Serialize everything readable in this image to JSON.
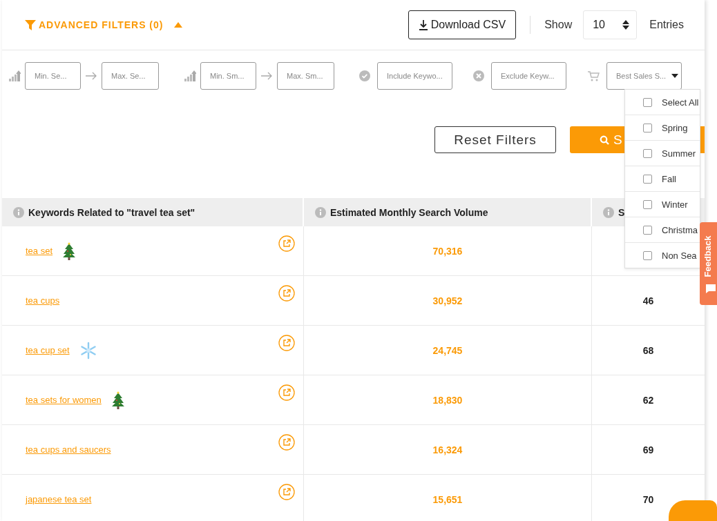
{
  "header": {
    "filters_title": "ADVANCED FILTERS (0)",
    "expanded": true,
    "download_button": "Download CSV",
    "show_label": "Show",
    "entries_value": "10",
    "entries_label": "Entries"
  },
  "filters": [
    {
      "kind": "range",
      "min_placeholder": "Min. Se...",
      "max_placeholder": "Max. Se..."
    },
    {
      "kind": "range",
      "min_placeholder": "Min. Sm...",
      "max_placeholder": "Max. Sm..."
    },
    {
      "kind": "include",
      "placeholder": "Include Keywo..."
    },
    {
      "kind": "exclude",
      "placeholder": "Exclude Keyw..."
    },
    {
      "kind": "select",
      "value": "Best Sales S..."
    }
  ],
  "season_options": [
    {
      "label": "Select All",
      "checked": false
    },
    {
      "label": "Spring",
      "checked": false
    },
    {
      "label": "Summer",
      "checked": false
    },
    {
      "label": "Fall",
      "checked": false
    },
    {
      "label": "Winter",
      "checked": false
    },
    {
      "label": "Christma",
      "checked": false
    },
    {
      "label": "Non Sea",
      "checked": false
    }
  ],
  "reset_button": "Reset Filters",
  "search_button": "S",
  "table": {
    "columns": [
      "Keywords Related to \"travel tea set\"",
      "Estimated Monthly Search Volume",
      "S"
    ],
    "rows": [
      {
        "kind": "christmas",
        "keyword": "tea set",
        "volume": "70,316"
      },
      {
        "kind": "plain",
        "keyword": "tea cups",
        "volume": "30,952",
        "column_3": "46"
      },
      {
        "kind": "winter",
        "keyword": "tea cup set",
        "volume": "24,745",
        "column_3": "68"
      },
      {
        "kind": "christmas",
        "keyword": "tea sets for women",
        "volume": "18,830",
        "column_3": "62"
      },
      {
        "kind": "plain",
        "keyword": "tea cups and saucers",
        "volume": "16,324",
        "column_3": "69"
      },
      {
        "kind": "plain",
        "keyword": "japanese tea set",
        "volume": "15,651",
        "column_3": "70"
      }
    ]
  },
  "feedback_tab": "Feedback"
}
